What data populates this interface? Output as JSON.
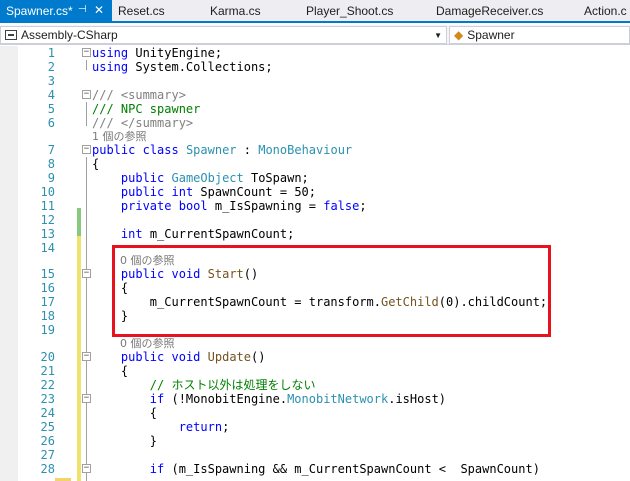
{
  "tabs": [
    {
      "label": "Spawner.cs*",
      "active": true
    },
    {
      "label": "Reset.cs"
    },
    {
      "label": "Karma.cs"
    },
    {
      "label": "Player_Shoot.cs"
    },
    {
      "label": "DamageReceiver.cs"
    },
    {
      "label": "Action.c"
    }
  ],
  "tab_icons": {
    "pin": "pin-icon",
    "close": "close-icon"
  },
  "navigation": {
    "project": "Assembly-CSharp",
    "class": "Spawner"
  },
  "code_lens": {
    "refs_1": "1 個の参照",
    "refs_0_start": "0 個の参照",
    "refs_0_update": "0 個の参照"
  },
  "line_numbers": [
    "1",
    "2",
    "3",
    "4",
    "5",
    "6",
    "7",
    "8",
    "9",
    "10",
    "11",
    "12",
    "13",
    "14",
    "15",
    "16",
    "17",
    "18",
    "19",
    "20",
    "21",
    "22",
    "23",
    "24",
    "25",
    "26",
    "27",
    "28"
  ],
  "code": {
    "l1": {
      "kw": "using",
      "rest": " UnityEngine;"
    },
    "l2": {
      "kw": "using",
      "rest": " System.Collections;"
    },
    "l4": "/// <summary>",
    "l5": "/// NPC spawner",
    "l6": "/// </summary>",
    "l7": {
      "kw1": "public",
      "kw2": "class",
      "type": "Spawner",
      "sep": " : ",
      "base": "MonoBehaviour"
    },
    "l8": "{",
    "l9": {
      "kw": "public",
      "type": "GameObject",
      "rest": " ToSpawn;"
    },
    "l10": {
      "kw1": "public",
      "kw2": "int",
      "rest": " SpawnCount = 50;"
    },
    "l11": {
      "kw1": "private",
      "kw2": "bool",
      "rest": " m_IsSpawning = ",
      "kw3": "false",
      "end": ";"
    },
    "l13": {
      "kw": "int",
      "rest": " m_CurrentSpawnCount;"
    },
    "l15": {
      "kw1": "public",
      "kw2": "void",
      "method": "Start",
      "rest": "()"
    },
    "l16": "{",
    "l17": {
      "pre": "m_CurrentSpawnCount = transform.",
      "method": "GetChild",
      "rest": "(0).childCount;"
    },
    "l18": "}",
    "l20": {
      "kw1": "public",
      "kw2": "void",
      "method": "Update",
      "rest": "()"
    },
    "l21": "{",
    "l22": "// ホスト以外は処理をしない",
    "l23": {
      "kw": "if",
      "pre": " (!MonobitEngine.",
      "type": "MonobitNetwork",
      "rest": ".isHost)"
    },
    "l24": "{",
    "l25": {
      "kw": "return",
      "rest": ";"
    },
    "l26": "}",
    "l28": {
      "kw": "if",
      "rest": " (m_IsSpawning && m_CurrentSpawnCount <  SpawnCount)"
    }
  }
}
